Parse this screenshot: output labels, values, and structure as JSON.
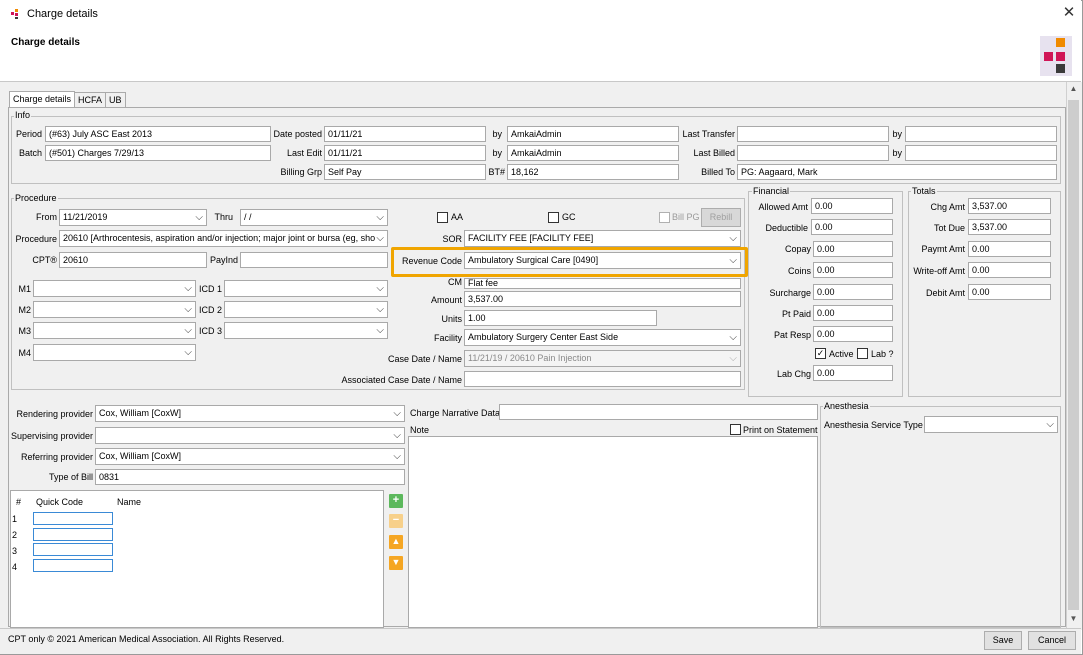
{
  "window": {
    "title": "Charge details"
  },
  "header": {
    "title": "Charge details"
  },
  "colors": {
    "accent": "#f0a500",
    "logo_red": "#d01557",
    "logo_orange": "#f08a00",
    "logo_dark": "#3a3a3a",
    "green": "#4caf50",
    "orange": "#f5a623"
  },
  "tabs": [
    "Charge details",
    "HCFA",
    "UB"
  ],
  "info": {
    "label": "Info",
    "period_label": "Period",
    "period": "(#63) July ASC East 2013",
    "batch_label": "Batch",
    "batch": "(#501) Charges 7/29/13",
    "date_posted_label": "Date posted",
    "date_posted": "01/11/21",
    "last_edit_label": "Last Edit",
    "last_edit": "01/11/21",
    "billing_grp_label": "Billing Grp",
    "billing_grp": "Self Pay",
    "by_label": "by",
    "by_posted": "AmkaiAdmin",
    "by_edit": "AmkaiAdmin",
    "bt_label": "BT#",
    "bt": "18,162",
    "last_transfer_label": "Last Transfer",
    "last_transfer": "",
    "last_billed_label": "Last Billed",
    "last_billed": "",
    "billed_to_label": "Billed To",
    "billed_to": "PG: Aagaard, Mark",
    "by_transfer": "",
    "by_billed": ""
  },
  "procedure": {
    "label": "Procedure",
    "from_label": "From",
    "from": "11/21/2019",
    "thru_label": "Thru",
    "thru": " / /",
    "procedure_label": "Procedure",
    "procedure": "20610  [Arthrocentesis, aspiration and/or injection; major joint or bursa (eg, sho",
    "cpt_label": "CPT®",
    "cpt": "20610",
    "payind_label": "PayInd",
    "payind": "",
    "m1_label": "M1",
    "m2_label": "M2",
    "m3_label": "M3",
    "m4_label": "M4",
    "icd1_label": "ICD 1",
    "icd2_label": "ICD 2",
    "icd3_label": "ICD 3",
    "aa_label": "AA",
    "gc_label": "GC",
    "billpg_label": "Bill PG",
    "rebill_label": "Rebill",
    "sor_label": "SOR",
    "sor": "FACILITY FEE  [FACILITY FEE]",
    "revenue_code_label": "Revenue Code",
    "revenue_code": "Ambulatory Surgical Care  [0490]",
    "cm_label": "CM",
    "cm": "Flat fee",
    "amount_label": "Amount",
    "amount": "3,537.00",
    "units_label": "Units",
    "units": "1.00",
    "facility_label": "Facility",
    "facility": "Ambulatory Surgery Center East Side",
    "case_date_label": "Case Date / Name",
    "case_date": "11/21/19 / 20610 Pain Injection",
    "assoc_case_label": "Associated Case Date / Name",
    "assoc_case": ""
  },
  "financial": {
    "label": "Financial",
    "allowed_amt_label": "Allowed Amt",
    "allowed_amt": "0.00",
    "deductible_label": "Deductible",
    "deductible": "0.00",
    "copay_label": "Copay",
    "copay": "0.00",
    "coins_label": "Coins",
    "coins": "0.00",
    "surcharge_label": "Surcharge",
    "surcharge": "0.00",
    "pt_paid_label": "Pt Paid",
    "pt_paid": "0.00",
    "pat_resp_label": "Pat Resp",
    "pat_resp": "0.00",
    "active_label": "Active",
    "lab_label": "Lab ?",
    "lab_chg_label": "Lab Chg",
    "lab_chg": "0.00"
  },
  "totals": {
    "label": "Totals",
    "chg_amt_label": "Chg Amt",
    "chg_amt": "3,537.00",
    "tot_due_label": "Tot Due",
    "tot_due": "3,537.00",
    "paymt_amt_label": "Paymt Amt",
    "paymt_amt": "0.00",
    "writeoff_amt_label": "Write-off Amt",
    "writeoff_amt": "0.00",
    "debit_amt_label": "Debit Amt",
    "debit_amt": "0.00"
  },
  "providers": {
    "rendering_label": "Rendering provider",
    "rendering": "Cox, William  [CoxW]",
    "supervising_label": "Supervising provider",
    "supervising": "",
    "referring_label": "Referring provider",
    "referring": "Cox, William  [CoxW]",
    "type_of_bill_label": "Type of Bill",
    "type_of_bill": "0831"
  },
  "quick_codes": {
    "col_num": "#",
    "col_code": "Quick Code",
    "col_name": "Name",
    "rows": [
      "1",
      "2",
      "3",
      "4"
    ]
  },
  "narrative": {
    "label": "Charge Narrative Data",
    "value": "",
    "note_label": "Note",
    "print_label": "Print on Statement"
  },
  "anesthesia": {
    "label": "Anesthesia",
    "service_type_label": "Anesthesia Service Type",
    "service_type": ""
  },
  "footer": {
    "copyright": "CPT only © 2021 American Medical Association.  All Rights Reserved.",
    "save_label": "Save",
    "cancel_label": "Cancel"
  }
}
